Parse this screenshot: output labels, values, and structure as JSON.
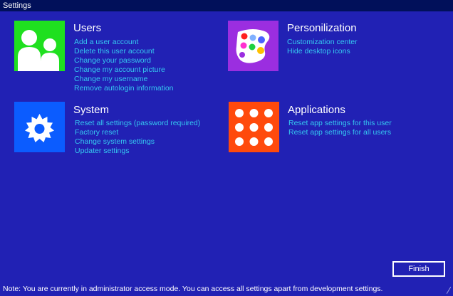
{
  "window": {
    "title": "Settings"
  },
  "sections": {
    "users": {
      "title": "Users",
      "icon": "users-icon",
      "color": "#1fe01f",
      "links": [
        "Add a user account",
        "Delete this user account",
        "Change your password",
        "Change my account picture",
        "Change my username",
        "Remove autologin information"
      ]
    },
    "personalization": {
      "title": "Personilization",
      "icon": "palette-icon",
      "color": "#9b2ee0",
      "links": [
        "Customization center",
        "Hide desktop icons"
      ]
    },
    "system": {
      "title": "System",
      "icon": "gear-icon",
      "color": "#0b5cff",
      "links": [
        "Reset all settings (password required)",
        "Factory reset",
        "Change system settings",
        "Updater settings"
      ]
    },
    "applications": {
      "title": "Applications",
      "icon": "app-grid-icon",
      "color": "#ff4a0c",
      "links": [
        "Reset app settings for this user",
        "Reset app settings for all users"
      ]
    }
  },
  "finish_button": {
    "label": "Finish"
  },
  "footer": {
    "note": "Note: You are currently in administrator access mode. You can access all settings apart from development settings."
  },
  "colors": {
    "background": "#2121b4",
    "titlebar": "#01105a",
    "link": "#35c8f0",
    "text": "#ffffff"
  }
}
